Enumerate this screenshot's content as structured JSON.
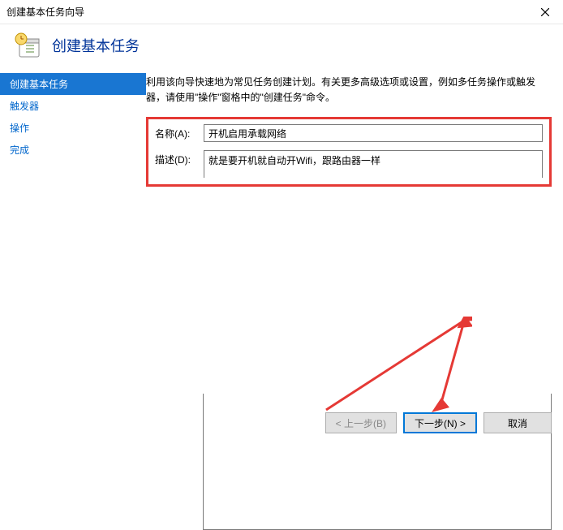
{
  "window": {
    "title": "创建基本任务向导"
  },
  "header": {
    "title": "创建基本任务"
  },
  "sidebar": {
    "items": [
      {
        "label": "创建基本任务",
        "active": true
      },
      {
        "label": "触发器",
        "active": false
      },
      {
        "label": "操作",
        "active": false
      },
      {
        "label": "完成",
        "active": false
      }
    ]
  },
  "main": {
    "instruction": "利用该向导快速地为常见任务创建计划。有关更多高级选项或设置，例如多任务操作或触发器，请使用\"操作\"窗格中的\"创建任务\"命令。",
    "name_label": "名称(A):",
    "name_value": "开机启用承载网络",
    "desc_label": "描述(D):",
    "desc_value": "就是要开机就自动开Wifi，跟路由器一样"
  },
  "buttons": {
    "back": "< 上一步(B)",
    "next": "下一步(N) >",
    "cancel": "取消"
  }
}
